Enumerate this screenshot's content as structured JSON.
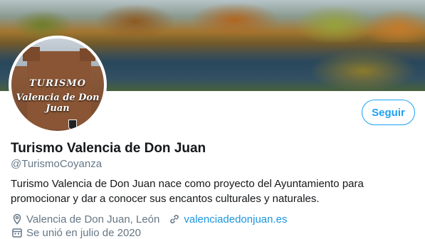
{
  "profile": {
    "name": "Turismo Valencia de Don Juan",
    "handle": "@TurismoCoyanza",
    "bio": "Turismo Valencia de Don Juan nace como proyecto del Ayuntamiento para promocionar y dar a conocer sus encantos culturales y naturales.",
    "location": "Valencia de Don Juan, León",
    "website": "valenciadedonjuan.es",
    "joined": "Se unió en julio de 2020"
  },
  "avatar": {
    "line1": "TURISMO",
    "line2": "Valencia de Don Juan"
  },
  "actions": {
    "follow_label": "Seguir"
  },
  "icons": {
    "location": "location-pin-icon",
    "link": "link-icon",
    "calendar": "calendar-icon"
  },
  "colors": {
    "accent": "#1da1f2",
    "link": "#1b95e0",
    "muted": "#657786",
    "text": "#14171a"
  }
}
